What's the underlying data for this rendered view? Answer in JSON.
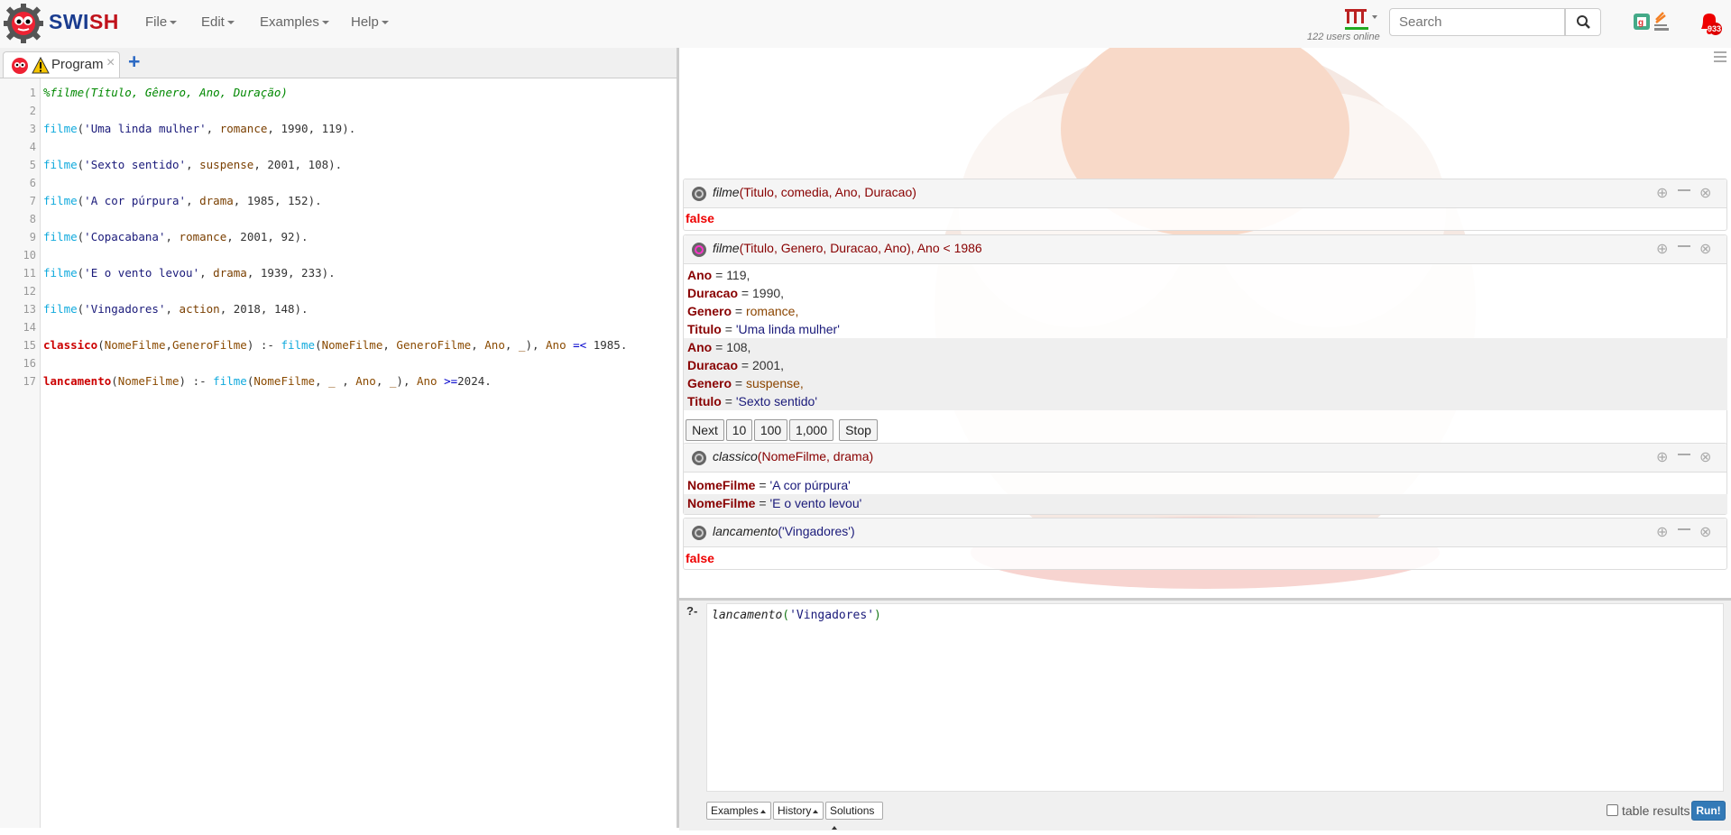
{
  "app": {
    "brand_a": "SWI",
    "brand_b": "SH"
  },
  "nav": {
    "menus": [
      "File",
      "Edit",
      "Examples",
      "Help"
    ],
    "users_online": "122 users online",
    "search_placeholder": "Search",
    "notification_count": "933"
  },
  "editor": {
    "tab_label": "Program",
    "tab_close": "×",
    "add_tab": "+",
    "line_numbers": [
      "1",
      "2",
      "3",
      "4",
      "5",
      "6",
      "7",
      "8",
      "9",
      "10",
      "11",
      "12",
      "13",
      "14",
      "15",
      "16",
      "17"
    ]
  },
  "answers": [
    {
      "query_pred": "filme",
      "query_args": "(Titulo, comedia, Ano, Duracao)",
      "result": "false"
    },
    {
      "query_pred": "filme",
      "query_args": "(Titulo, Genero, Duracao, Ano), Ano < 1986",
      "solutions": [
        [
          {
            "var": "Ano",
            "value": "119,"
          },
          {
            "var": "Duracao",
            "value": "1990,"
          },
          {
            "var": "Genero",
            "value": "romance,"
          },
          {
            "var": "Titulo",
            "value": "'Uma linda mulher'"
          }
        ],
        [
          {
            "var": "Ano",
            "value": "108,"
          },
          {
            "var": "Duracao",
            "value": "2001,"
          },
          {
            "var": "Genero",
            "value": "suspense,"
          },
          {
            "var": "Titulo",
            "value": "'Sexto sentido'"
          }
        ]
      ],
      "buttons": [
        "Next",
        "10",
        "100",
        "1,000",
        "Stop"
      ]
    },
    {
      "query_pred": "classico",
      "query_args": "(NomeFilme, drama)",
      "solutions": [
        {
          "var": "NomeFilme",
          "value": "'A cor púrpura'"
        },
        {
          "var": "NomeFilme",
          "value": "'E o vento levou'"
        }
      ]
    },
    {
      "query_pred": "lancamento",
      "query_args": "('Vingadores')",
      "result": "false"
    }
  ],
  "query_editor": {
    "prompt": "?-",
    "query_pred": "lancamento",
    "query_open": "(",
    "query_string": "'Vingadores'",
    "query_close": ")",
    "examples_label": "Examples",
    "history_label": "History",
    "solutions_label": "Solutions",
    "table_results_label": "table results",
    "run_label": "Run!"
  },
  "colors": {
    "brand_blue": "#1a3c8f",
    "brand_red": "#c0121b",
    "false_red": "#e00000",
    "run_blue": "#337ab7",
    "predicate_cyan": "#11aadd"
  }
}
